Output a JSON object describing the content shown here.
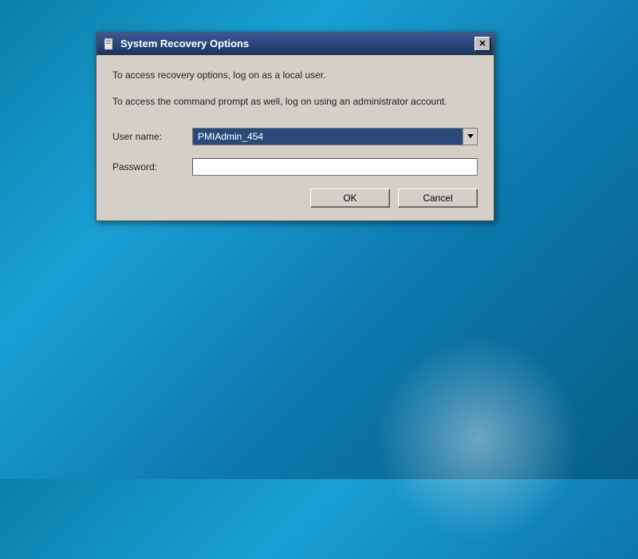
{
  "dialog": {
    "title": "System Recovery Options",
    "message1": "To access recovery options, log on as a local user.",
    "message2": "To access the command prompt as well, log on using an administrator account.",
    "username_label": "User name:",
    "username_value": "PMIAdmin_454",
    "password_label": "Password:",
    "password_value": "",
    "ok_label": "OK",
    "cancel_label": "Cancel"
  }
}
